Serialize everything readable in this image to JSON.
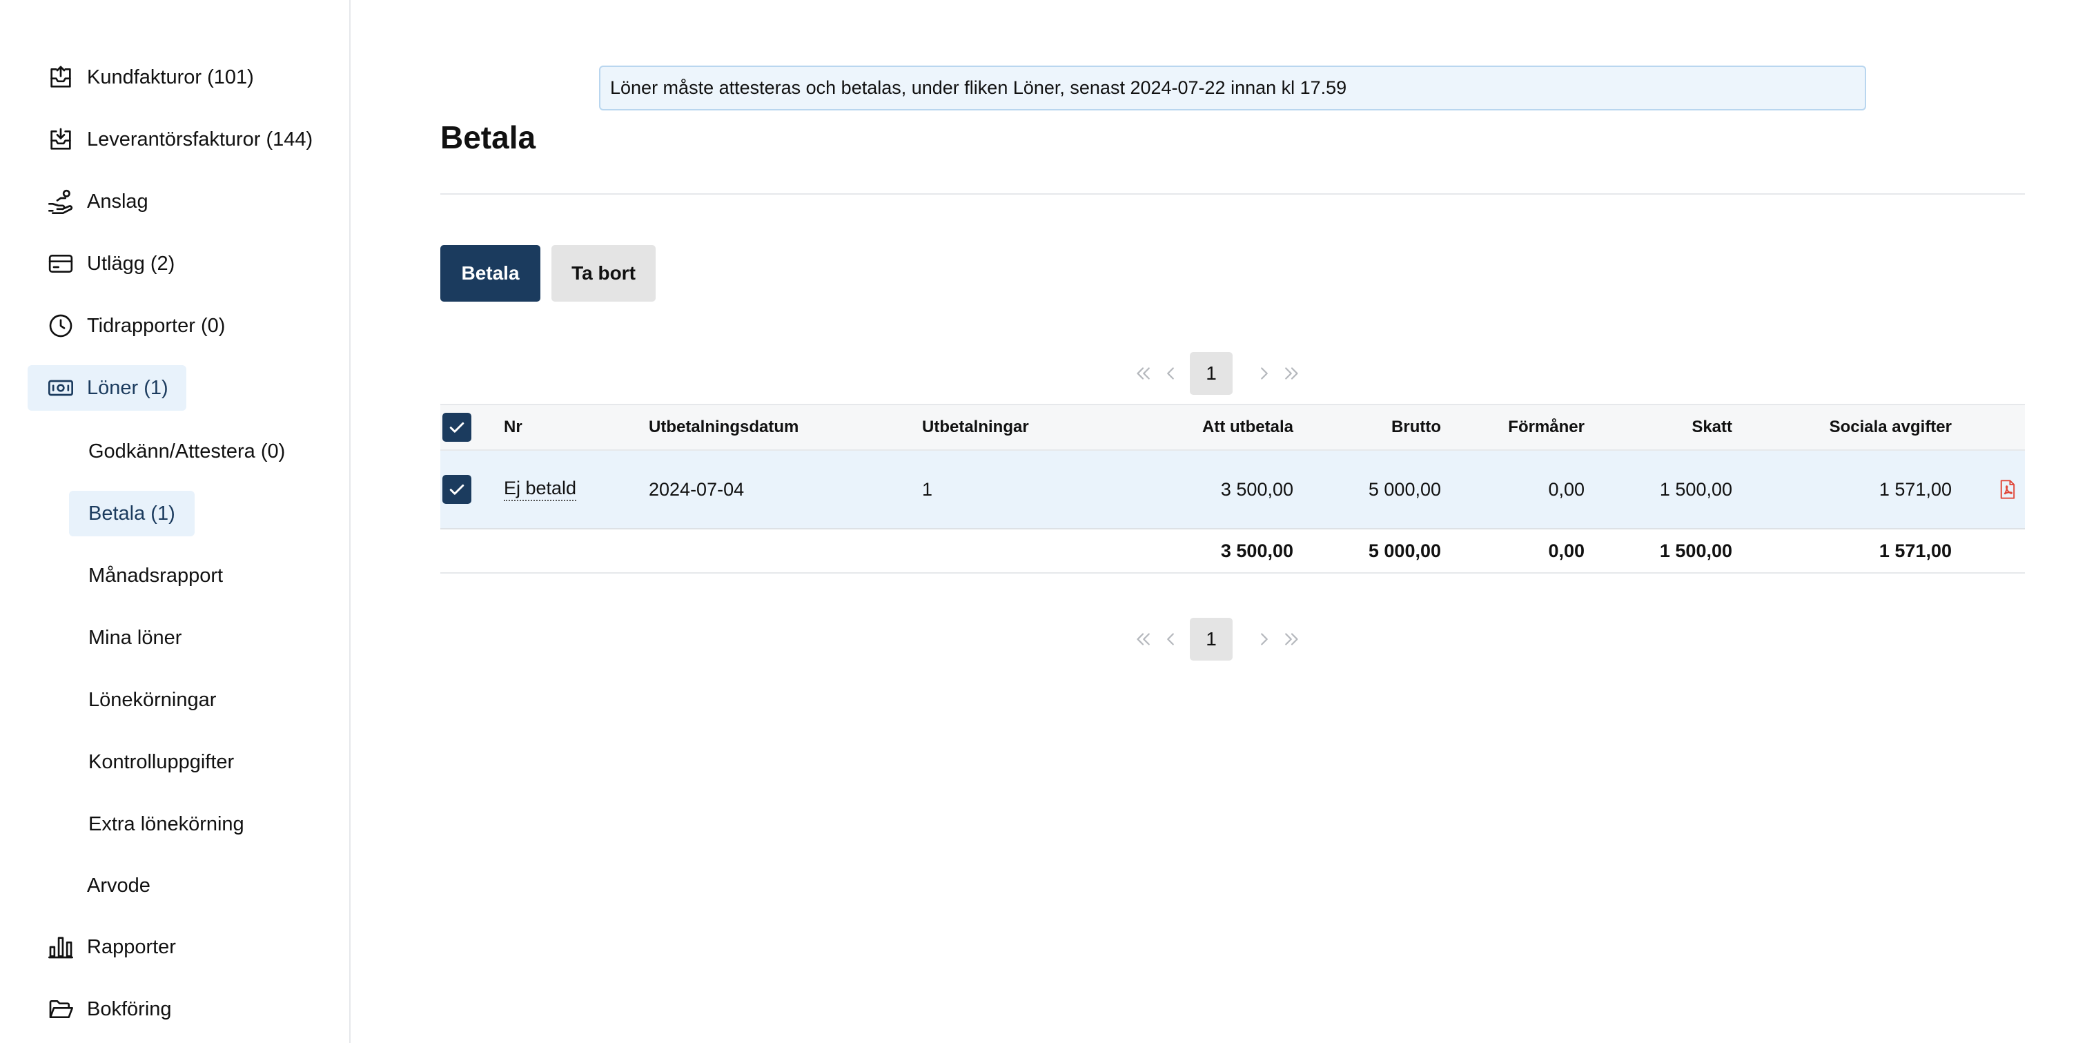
{
  "sidebar": {
    "items": [
      {
        "label": "Kundfakturor (101)",
        "icon": "inbox-upload-icon"
      },
      {
        "label": "Leverantörsfakturor (144)",
        "icon": "inbox-download-icon"
      },
      {
        "label": "Anslag",
        "icon": "hand-coins-icon"
      },
      {
        "label": "Utlägg (2)",
        "icon": "credit-card-icon"
      },
      {
        "label": "Tidrapporter (0)",
        "icon": "clock-icon"
      },
      {
        "label": "Löner (1)",
        "icon": "banknote-icon",
        "active": true
      }
    ],
    "subitems": [
      {
        "label": "Godkänn/Attestera (0)"
      },
      {
        "label": "Betala (1)",
        "active": true
      },
      {
        "label": "Månadsrapport"
      },
      {
        "label": "Mina löner"
      },
      {
        "label": "Lönekörningar"
      },
      {
        "label": "Kontrolluppgifter"
      },
      {
        "label": "Extra lönekörning"
      }
    ],
    "more_items": [
      {
        "label": "Arvode",
        "icon": ""
      },
      {
        "label": "Rapporter",
        "icon": "bar-chart-icon"
      },
      {
        "label": "Bokföring",
        "icon": "folder-open-icon"
      }
    ]
  },
  "notice": {
    "text": "Löner måste attesteras och betalas, under fliken Löner, senast 2024-07-22 innan kl 17.59"
  },
  "page": {
    "title": "Betala"
  },
  "actions": {
    "pay_label": "Betala",
    "delete_label": "Ta bort"
  },
  "pagination": {
    "current_page": "1"
  },
  "table": {
    "headers": {
      "nr": "Nr",
      "date": "Utbetalningsdatum",
      "payments": "Utbetalningar",
      "net": "Att utbetala",
      "gross": "Brutto",
      "benefits": "Förmåner",
      "tax": "Skatt",
      "social": "Sociala avgifter"
    },
    "rows": [
      {
        "checked": true,
        "nr": "Ej betald",
        "date": "2024-07-04",
        "payments": "1",
        "net": "3 500,00",
        "gross": "5 000,00",
        "benefits": "0,00",
        "tax": "1 500,00",
        "social": "1 571,00",
        "icon": "pdf-icon"
      }
    ],
    "totals": {
      "net": "3 500,00",
      "gross": "5 000,00",
      "benefits": "0,00",
      "tax": "1 500,00",
      "social": "1 571,00"
    }
  },
  "colors": {
    "primary": "#1b3b5e",
    "active_bg": "#e8f2fb",
    "notice_bg": "#edf5fc",
    "notice_border": "#b9d6ef",
    "pdf_red": "#e0473a"
  }
}
